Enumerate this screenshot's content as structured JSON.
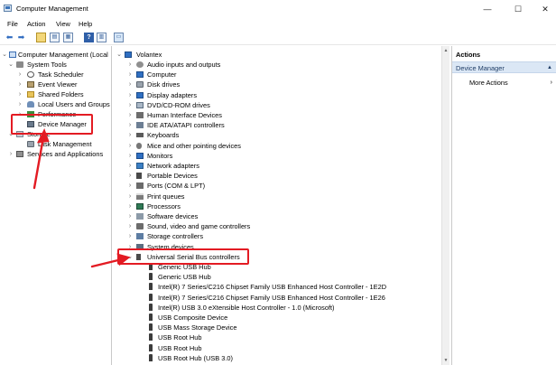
{
  "window": {
    "title": "Computer Management",
    "controls": {
      "minimize": "—",
      "maximize": "☐",
      "close": "✕"
    }
  },
  "menu": [
    "File",
    "Action",
    "View",
    "Help"
  ],
  "toolbar": {
    "icons": [
      "back-arrow-icon",
      "forward-arrow-icon",
      "up-folder-icon",
      "show-hide-tree-icon",
      "properties-icon",
      "help-icon",
      "action-pane-icon",
      "monitor-icon"
    ],
    "help_label": "?"
  },
  "left_tree": [
    {
      "label": "Computer Management (Local",
      "icon": "computer-icon",
      "expander": "⌄",
      "level": 0
    },
    {
      "label": "System Tools",
      "icon": "tools-icon",
      "expander": "⌄",
      "level": 1
    },
    {
      "label": "Task Scheduler",
      "icon": "clock-icon",
      "expander": "›",
      "level": 2
    },
    {
      "label": "Event Viewer",
      "icon": "event-viewer-icon",
      "expander": "›",
      "level": 2
    },
    {
      "label": "Shared Folders",
      "icon": "folder-icon",
      "expander": "›",
      "level": 2
    },
    {
      "label": "Local Users and Groups",
      "icon": "users-icon",
      "expander": "›",
      "level": 2
    },
    {
      "label": "Performance",
      "icon": "performance-icon",
      "expander": "›",
      "level": 2
    },
    {
      "label": "Device Manager",
      "icon": "device-manager-icon",
      "expander": "",
      "level": 2
    },
    {
      "label": "Storage",
      "icon": "storage-icon",
      "expander": "⌄",
      "level": 1
    },
    {
      "label": "Disk Management",
      "icon": "disk-icon",
      "expander": "",
      "level": 2
    },
    {
      "label": "Services and Applications",
      "icon": "services-icon",
      "expander": "›",
      "level": 1
    }
  ],
  "device_tree": {
    "root": {
      "label": "Volantex",
      "icon": "computer-icon",
      "expander": "⌄"
    },
    "categories": [
      {
        "label": "Audio inputs and outputs",
        "icon": "audio-icon"
      },
      {
        "label": "Computer",
        "icon": "computer-icon"
      },
      {
        "label": "Disk drives",
        "icon": "disk-icon"
      },
      {
        "label": "Display adapters",
        "icon": "monitor-icon"
      },
      {
        "label": "DVD/CD-ROM drives",
        "icon": "dvd-icon"
      },
      {
        "label": "Human Interface Devices",
        "icon": "hid-icon"
      },
      {
        "label": "IDE ATA/ATAPI controllers",
        "icon": "ide-icon"
      },
      {
        "label": "Keyboards",
        "icon": "keyboard-icon"
      },
      {
        "label": "Mice and other pointing devices",
        "icon": "mouse-icon"
      },
      {
        "label": "Monitors",
        "icon": "monitor-icon"
      },
      {
        "label": "Network adapters",
        "icon": "network-icon"
      },
      {
        "label": "Portable Devices",
        "icon": "portable-icon"
      },
      {
        "label": "Ports (COM & LPT)",
        "icon": "port-icon"
      },
      {
        "label": "Print queues",
        "icon": "printer-icon"
      },
      {
        "label": "Processors",
        "icon": "processor-icon"
      },
      {
        "label": "Software devices",
        "icon": "software-icon"
      },
      {
        "label": "Sound, video and game controllers",
        "icon": "sound-icon"
      },
      {
        "label": "Storage controllers",
        "icon": "storage-controller-icon"
      },
      {
        "label": "System devices",
        "icon": "system-icon"
      },
      {
        "label": "Universal Serial Bus controllers",
        "icon": "usb-root-icon",
        "expanded": true
      }
    ],
    "usb_children": [
      "Generic USB Hub",
      "Generic USB Hub",
      "Intel(R) 7 Series/C216 Chipset Family USB Enhanced Host Controller - 1E2D",
      "Intel(R) 7 Series/C216 Chipset Family USB Enhanced Host Controller - 1E26",
      "Intel(R) USB 3.0 eXtensible Host Controller - 1.0 (Microsoft)",
      "USB Composite Device",
      "USB Mass Storage Device",
      "USB Root Hub",
      "USB Root Hub",
      "USB Root Hub (USB 3.0)"
    ]
  },
  "actions_pane": {
    "header": "Actions",
    "section": "Device Manager",
    "section_caret": "▲",
    "more": "More Actions",
    "more_caret": "›"
  },
  "colors": {
    "annotation": "#e31b23",
    "selection": "#cde8ff",
    "actions_section_bg": "#dbe7f5"
  }
}
